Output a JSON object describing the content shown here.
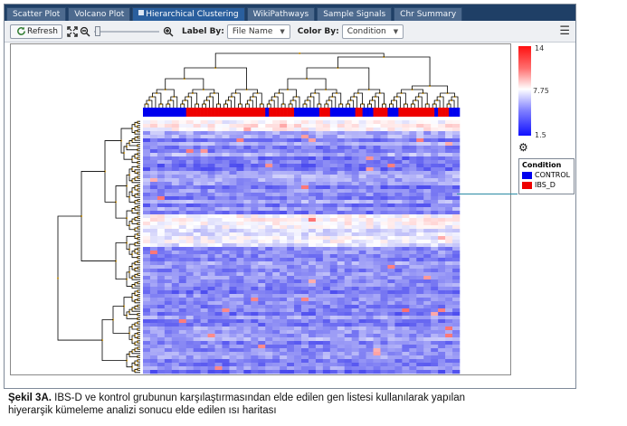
{
  "tabs": [
    {
      "label": "Scatter Plot",
      "active": false
    },
    {
      "label": "Volcano Plot",
      "active": false
    },
    {
      "label": "Hierarchical Clustering",
      "active": true
    },
    {
      "label": "WikiPathways",
      "active": false
    },
    {
      "label": "Sample Signals",
      "active": false
    },
    {
      "label": "Chr Summary",
      "active": false
    }
  ],
  "toolbar": {
    "refresh_label": "Refresh",
    "label_by_label": "Label By:",
    "label_by_value": "File Name",
    "color_by_label": "Color By:",
    "color_by_value": "Condition"
  },
  "icons": {
    "refresh": "refresh-icon",
    "fit": "fit-to-screen-icon",
    "zoom_out": "zoom-out-icon",
    "zoom_in": "zoom-in-icon",
    "menu": "hamburger-menu-icon",
    "settings": "gear-icon"
  },
  "colors": {
    "high": "#ff1010",
    "mid": "#ffffff",
    "low": "#1010ff",
    "control": "#0000ee",
    "ibs_d": "#ee0000",
    "tab_bar": "#1f3f66",
    "active_tab": "#2a5f9e"
  },
  "scale": {
    "max": "14",
    "mid": "7.75",
    "min": "1.5"
  },
  "legend": {
    "title": "Condition",
    "items": [
      {
        "label": "CONTROL",
        "color": "#0000ee"
      },
      {
        "label": "IBS_D",
        "color": "#ee0000"
      }
    ]
  },
  "chart_data": {
    "type": "heatmap",
    "color_scale": {
      "min": 1.5,
      "mid": 7.75,
      "max": 14
    },
    "condition_bar": [
      "CONTROL",
      "CONTROL",
      "CONTROL",
      "CONTROL",
      "CONTROL",
      "CONTROL",
      "CONTROL",
      "CONTROL",
      "CONTROL",
      "CONTROL",
      "CONTROL",
      "CONTROL",
      "IBS_D",
      "IBS_D",
      "IBS_D",
      "IBS_D",
      "IBS_D",
      "IBS_D",
      "IBS_D",
      "IBS_D",
      "IBS_D",
      "IBS_D",
      "IBS_D",
      "IBS_D",
      "IBS_D",
      "IBS_D",
      "IBS_D",
      "IBS_D",
      "IBS_D",
      "IBS_D",
      "IBS_D",
      "IBS_D",
      "IBS_D",
      "IBS_D",
      "CONTROL",
      "IBS_D",
      "IBS_D",
      "IBS_D",
      "IBS_D",
      "IBS_D",
      "IBS_D",
      "IBS_D",
      "CONTROL",
      "CONTROL",
      "CONTROL",
      "CONTROL",
      "CONTROL",
      "CONTROL",
      "CONTROL",
      "IBS_D",
      "IBS_D",
      "IBS_D",
      "CONTROL",
      "CONTROL",
      "CONTROL",
      "CONTROL",
      "CONTROL",
      "CONTROL",
      "CONTROL",
      "IBS_D",
      "IBS_D",
      "CONTROL",
      "CONTROL",
      "CONTROL",
      "IBS_D",
      "IBS_D",
      "IBS_D",
      "IBS_D",
      "CONTROL",
      "CONTROL",
      "CONTROL",
      "IBS_D",
      "IBS_D",
      "IBS_D",
      "IBS_D",
      "IBS_D",
      "IBS_D",
      "IBS_D",
      "IBS_D",
      "IBS_D",
      "IBS_D",
      "CONTROL",
      "IBS_D",
      "IBS_D",
      "IBS_D",
      "CONTROL",
      "CONTROL",
      "CONTROL"
    ]
  },
  "caption": {
    "bold": "Şekil 3A.",
    "line1": " IBS-D ve kontrol grubunun karşılaştırmasından elde edilen gen listesi kullanılarak yapılan",
    "line2": "hiyerarşik kümeleme analizi sonucu elde edilen ısı haritası"
  }
}
